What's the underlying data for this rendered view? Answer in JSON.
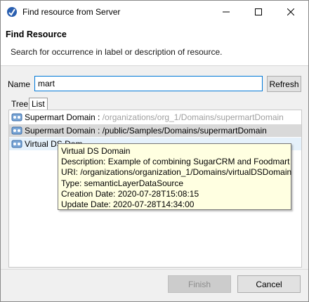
{
  "window": {
    "title": "Find resource from Server"
  },
  "header": {
    "title": "Find Resource",
    "description": "Search for occurrence in label or description of resource."
  },
  "search": {
    "label": "Name",
    "value": "mart",
    "refresh_label": "Refresh"
  },
  "tabs": [
    {
      "label": "Tree"
    },
    {
      "label": "List"
    }
  ],
  "results": [
    {
      "name": "Supermart Domain :",
      "path": "/organizations/org_1/Domains/supermartDomain"
    },
    {
      "name": "Supermart Domain :",
      "path": "/public/Samples/Domains/supermartDomain"
    },
    {
      "name": "Virtual DS Dom"
    }
  ],
  "tooltip": {
    "name": "Virtual DS Domain",
    "description": "Description: Example of combining SugarCRM and Foodmart",
    "uri": "URI: /organizations/organization_1/Domains/virtualDSDomain",
    "type": "Type: semanticLayerDataSource",
    "created": "Creation Date: 2020-07-28T15:08:15",
    "updated": "Update Date: 2020-07-28T14:34:00"
  },
  "footer": {
    "finish_label": "Finish",
    "cancel_label": "Cancel"
  },
  "colors": {
    "accent": "#0078d7",
    "tooltip_bg": "#ffffe1",
    "selected_row": "#d9d9d9"
  }
}
